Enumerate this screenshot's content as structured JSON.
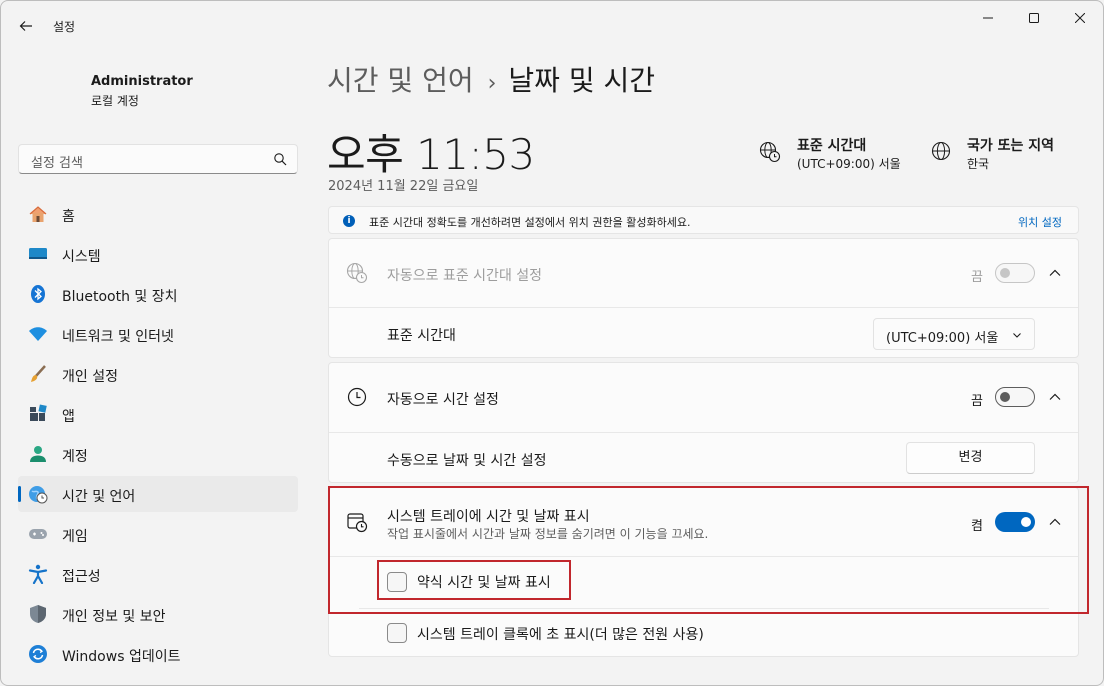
{
  "window": {
    "app_title": "설정"
  },
  "profile": {
    "name": "Administrator",
    "type": "로컬 계정"
  },
  "search": {
    "placeholder": "설정 검색"
  },
  "sidebar": {
    "items": [
      {
        "label": "홈",
        "icon": "home-icon"
      },
      {
        "label": "시스템",
        "icon": "system-icon"
      },
      {
        "label": "Bluetooth 및 장치",
        "icon": "bluetooth-icon"
      },
      {
        "label": "네트워크 및 인터넷",
        "icon": "wifi-icon"
      },
      {
        "label": "개인 설정",
        "icon": "brush-icon"
      },
      {
        "label": "앱",
        "icon": "apps-icon"
      },
      {
        "label": "계정",
        "icon": "account-icon"
      },
      {
        "label": "시간 및 언어",
        "icon": "globe-clock-icon",
        "active": true
      },
      {
        "label": "게임",
        "icon": "gamepad-icon"
      },
      {
        "label": "접근성",
        "icon": "accessibility-icon"
      },
      {
        "label": "개인 정보 및 보안",
        "icon": "shield-icon"
      },
      {
        "label": "Windows 업데이트",
        "icon": "update-icon"
      }
    ]
  },
  "breadcrumb": {
    "parent": "시간 및 언어",
    "separator": "›",
    "current": "날짜 및 시간"
  },
  "clock": {
    "time": "오후 11:53",
    "date": "2024년 11월 22일 금요일"
  },
  "timezone_info": {
    "title": "표준 시간대",
    "value": "(UTC+09:00) 서울"
  },
  "region_info": {
    "title": "국가 또는 지역",
    "value": "한국"
  },
  "banner": {
    "text": "표준 시간대 정확도를 개선하려면 설정에서 위치 권한을 활성화하세요.",
    "link": "위치 설정"
  },
  "auto_timezone": {
    "label": "자동으로 표준 시간대 설정",
    "state": "끔",
    "on": false,
    "disabled": true
  },
  "timezone_row": {
    "label": "표준 시간대",
    "selected": "(UTC+09:00) 서울"
  },
  "auto_time": {
    "label": "자동으로 시간 설정",
    "state": "끔",
    "on": false
  },
  "manual_time": {
    "label": "수동으로 날짜 및 시간 설정",
    "button": "변경"
  },
  "tray_time": {
    "label": "시스템 트레이에 시간 및 날짜 표시",
    "sub": "작업 표시줄에서 시간과 날짜 정보를 숨기려면 이 기능을 끄세요.",
    "state": "켬",
    "on": true
  },
  "short_time_checkbox": {
    "label": "약식 시간 및 날짜 표시",
    "checked": false
  },
  "seconds_checkbox": {
    "label": "시스템 트레이 클록에 초 표시(더 많은 전원 사용)",
    "checked": false
  },
  "colors": {
    "accent": "#0067c0",
    "highlight_box": "#c1272d"
  }
}
